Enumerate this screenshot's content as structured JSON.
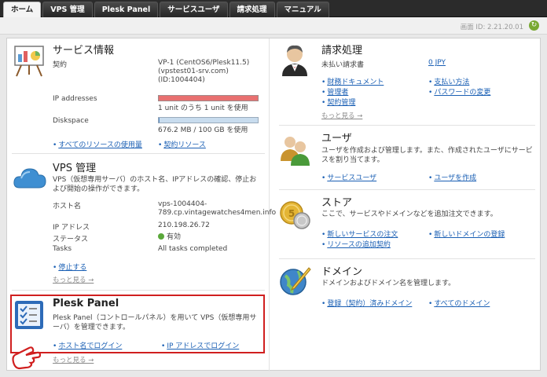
{
  "tabs": [
    "ホーム",
    "VPS 管理",
    "Plesk Panel",
    "サービスユーザ",
    "請求処理",
    "マニュアル"
  ],
  "server_id": "画面 ID: 2.21.20.01",
  "service_info": {
    "title": "サービス情報",
    "contract_label": "契約",
    "contract_value_1": "VP-1 (CentOS6/Plesk11.5)",
    "contract_value_2": "(vpstest01-srv.com)",
    "contract_value_3": "(ID:1004404)",
    "ip_label": "IP addresses",
    "ip_usage": "1 unit のうち 1 unit を使用",
    "ip_used_fraction": 1.0,
    "disk_label": "Diskspace",
    "disk_usage": "676.2 MB / 100 GB を使用",
    "disk_used_fraction": 0.0066,
    "link_all_resources": "すべてのリソースの使用量",
    "link_contract_resources": "契約リソース",
    "colors": {
      "ip_bar": "#e87070",
      "disk_bar": "#c8dcee"
    }
  },
  "vps": {
    "title": "VPS 管理",
    "desc": "VPS（仮想専用サーバ）のホスト名、IPアドレスの確認、停止および開始の操作ができます。",
    "host_label": "ホスト名",
    "host_value_1": "vps-1004404-",
    "host_value_2": "789.cp.vintagewatches4men.info",
    "ip_label": "IP アドレス",
    "ip_value": "210.198.26.72",
    "status_label": "ステータス",
    "status_value": "有効",
    "tasks_label": "Tasks",
    "tasks_value": "All tasks completed",
    "link_stop": "停止する",
    "more": "もっと見る →"
  },
  "plesk": {
    "title": "Plesk Panel",
    "desc": "Plesk Panel（コントロールパネル）を用いて VPS（仮想専用サーバ）を管理できます。",
    "link_host_login": "ホスト名でログイン",
    "link_ip_login": "IP アドレスでログイン",
    "more": "もっと見る →"
  },
  "billing": {
    "title": "請求処理",
    "unpaid_label": "未払い請求書",
    "unpaid_value": "0 JPY",
    "link_financial_docs": "財務ドキュメント",
    "link_admin": "管理者",
    "link_contract_mgmt": "契約管理",
    "link_payment": "支払い方法",
    "link_password": "パスワードの変更",
    "more": "もっと見る →"
  },
  "users": {
    "title": "ユーザ",
    "desc": "ユーザを作成および管理します。また、作成されたユーザにサービスを割り当てます。",
    "link_service_users": "サービスユーザ",
    "link_create_user": "ユーザを作成"
  },
  "store": {
    "title": "ストア",
    "desc": "ここで、サービスやドメインなどを追加注文できます。",
    "link_new_service": "新しいサービスの注文",
    "link_new_domain": "新しいドメインの登録",
    "link_add_resources": "リソースの追加契約"
  },
  "domains": {
    "title": "ドメイン",
    "desc": "ドメインおよびドメイン名を管理します。",
    "link_registered": "登録（契約）済みドメイン",
    "link_all_domains": "すべてのドメイン"
  }
}
